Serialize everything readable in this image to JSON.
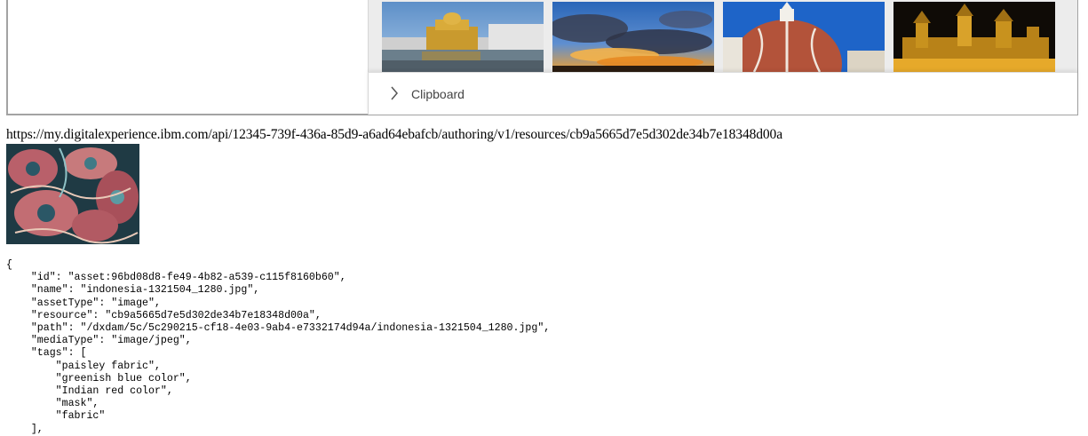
{
  "gallery": {
    "thumbnails": [
      {
        "name": "golden-temple-thumbnail"
      },
      {
        "name": "sunset-clouds-thumbnail"
      },
      {
        "name": "florence-dome-thumbnail"
      },
      {
        "name": "castle-night-thumbnail"
      }
    ]
  },
  "clipboard": {
    "label": "Clipboard",
    "icon": "chevron-right-icon"
  },
  "resource_url": "https://my.digitalexperience.ibm.com/api/12345-739f-436a-85d9-a6ad64ebafcb/authoring/v1/resources/cb9a5665d7e5d302de34b7e18348d00a",
  "asset_json": {
    "open_brace": "{",
    "lines": [
      "    \"id\": \"asset:96bd08d8-fe49-4b82-a539-c115f8160b60\",",
      "    \"name\": \"indonesia-1321504_1280.jpg\",",
      "    \"assetType\": \"image\",",
      "    \"resource\": \"cb9a5665d7e5d302de34b7e18348d00a\",",
      "    \"path\": \"/dxdam/5c/5c290215-cf18-4e03-9ab4-e7332174d94a/indonesia-1321504_1280.jpg\",",
      "    \"mediaType\": \"image/jpeg\",",
      "    \"tags\": [",
      "        \"paisley fabric\",",
      "        \"greenish blue color\",",
      "        \"Indian red color\",",
      "        \"mask\",",
      "        \"fabric\"",
      "    ],"
    ]
  }
}
